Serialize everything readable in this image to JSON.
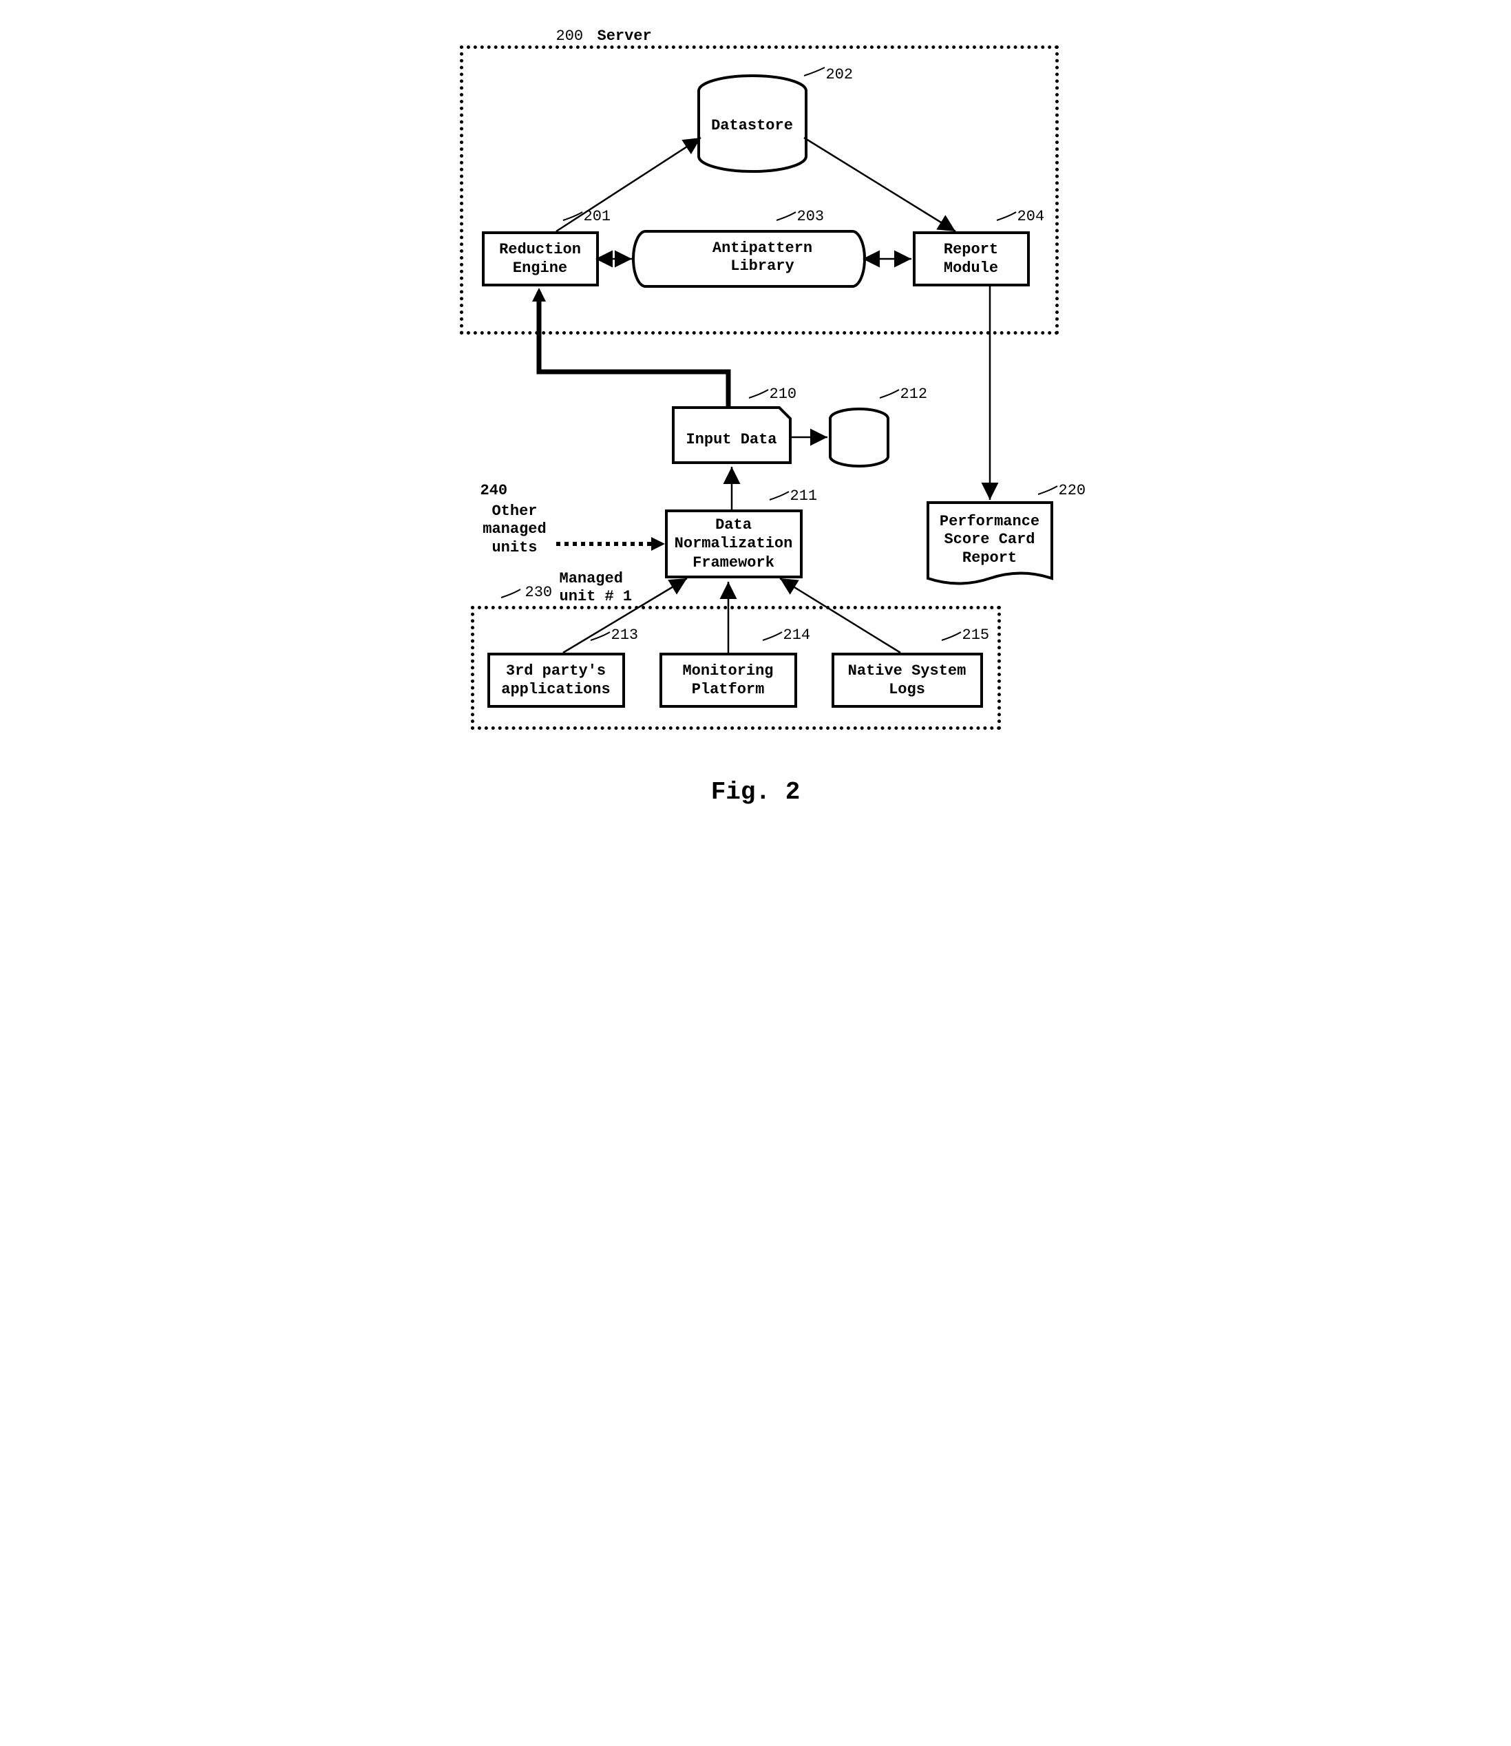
{
  "figure_label": "Fig. 2",
  "server": {
    "ref": "200",
    "title": "Server",
    "datastore": {
      "ref": "202",
      "label": "Datastore"
    },
    "reduction": {
      "ref": "201",
      "label": "Reduction\nEngine"
    },
    "antipattern": {
      "ref": "203",
      "label": "Antipattern\nLibrary"
    },
    "report": {
      "ref": "204",
      "label": "Report\nModule"
    }
  },
  "input_data": {
    "ref": "210",
    "label": "Input Data"
  },
  "small_db": {
    "ref": "212"
  },
  "normalization": {
    "ref": "211",
    "label": "Data\nNormalization\nFramework"
  },
  "score_card": {
    "ref": "220",
    "label": "Performance\nScore Card\nReport"
  },
  "other_units": {
    "ref": "240",
    "label": "Other\nmanaged\nunits"
  },
  "managed_unit": {
    "ref": "230",
    "title": "Managed\nunit # 1",
    "third_party": {
      "ref": "213",
      "label": "3rd party's\napplications"
    },
    "monitoring": {
      "ref": "214",
      "label": "Monitoring\nPlatform"
    },
    "native_logs": {
      "ref": "215",
      "label": "Native System\nLogs"
    }
  }
}
